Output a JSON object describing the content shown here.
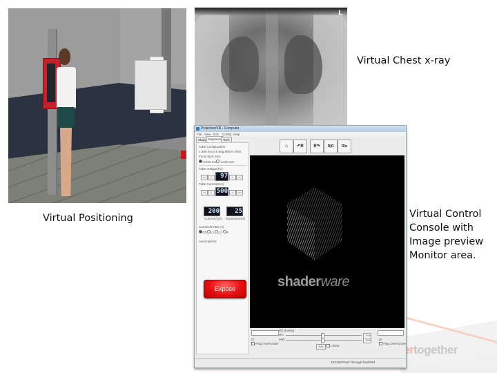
{
  "captions": {
    "xray": "Virtual Chest x-ray",
    "positioning": "Virtual Positioning",
    "console": "Virtual Control Console with Image preview Monitor area."
  },
  "xray_image": {
    "marker": "L"
  },
  "background_brand": {
    "accent_part": "er",
    "rest": "together"
  },
  "console": {
    "title": "ProjectionVR - Computer",
    "menu": [
      "File",
      "View",
      "DXL",
      "Config",
      "Help"
    ],
    "tabs": [
      "Study",
      "Exposure",
      "Tech Data"
    ],
    "active_tab": "Exposure",
    "left_panel": {
      "tube_config_label": "Tube Configuration",
      "tube_config_value": "1.400 mm  0.8 deg  800 kV 80H",
      "focal_spot_label": "Focal Spot Size",
      "focal_spot_options": [
        "0.600 mm",
        "1.400 mm"
      ],
      "focal_spot_selected": "0.600 mm",
      "tube_voltage_label": "Tube Voltage(kV)",
      "tube_voltage_value": "97",
      "tube_current_label": "Tube Current(mA)",
      "tube_current_value": "500",
      "current_label": "Current (mA)",
      "current_value": "200",
      "exposure_label": "Exposure(ms)",
      "exposure_value": "25",
      "aec_label": "Comment/AEC (s)",
      "aec_options": [
        "Off",
        "L1",
        "L2",
        "R"
      ],
      "aec_selected": "Off",
      "assumptions_label": "Assumptions",
      "stepper_buttons": [
        "<<",
        "<",
        ">",
        ">>"
      ],
      "expose_label": "Expose"
    },
    "toolbar": [
      {
        "name": "home",
        "glyph": "⌂"
      },
      {
        "name": "rotate-left",
        "glyph": "↶R"
      },
      {
        "name": "rotate-right",
        "glyph": "R↷"
      },
      {
        "name": "flip-horizontal",
        "glyph": "R|Я"
      },
      {
        "name": "flip-vertical",
        "glyph": "R/ᴚ"
      }
    ],
    "monitor": {
      "logo_bold": "shader",
      "logo_light": "ware"
    },
    "bottom": {
      "left_id_label": "ID",
      "left_checkbox": "Flag Over/Under",
      "windowing_label": "Windowing",
      "wc_label": "WC",
      "ww_label": "WW",
      "wc_value": "2048",
      "ww_value": "4096",
      "auto_label": "Auto",
      "linear_label": "Linear",
      "right_id_label": "ID",
      "right_checkbox": "Flag Over/Under"
    },
    "status": "DICOM Pass Through Disabled"
  }
}
